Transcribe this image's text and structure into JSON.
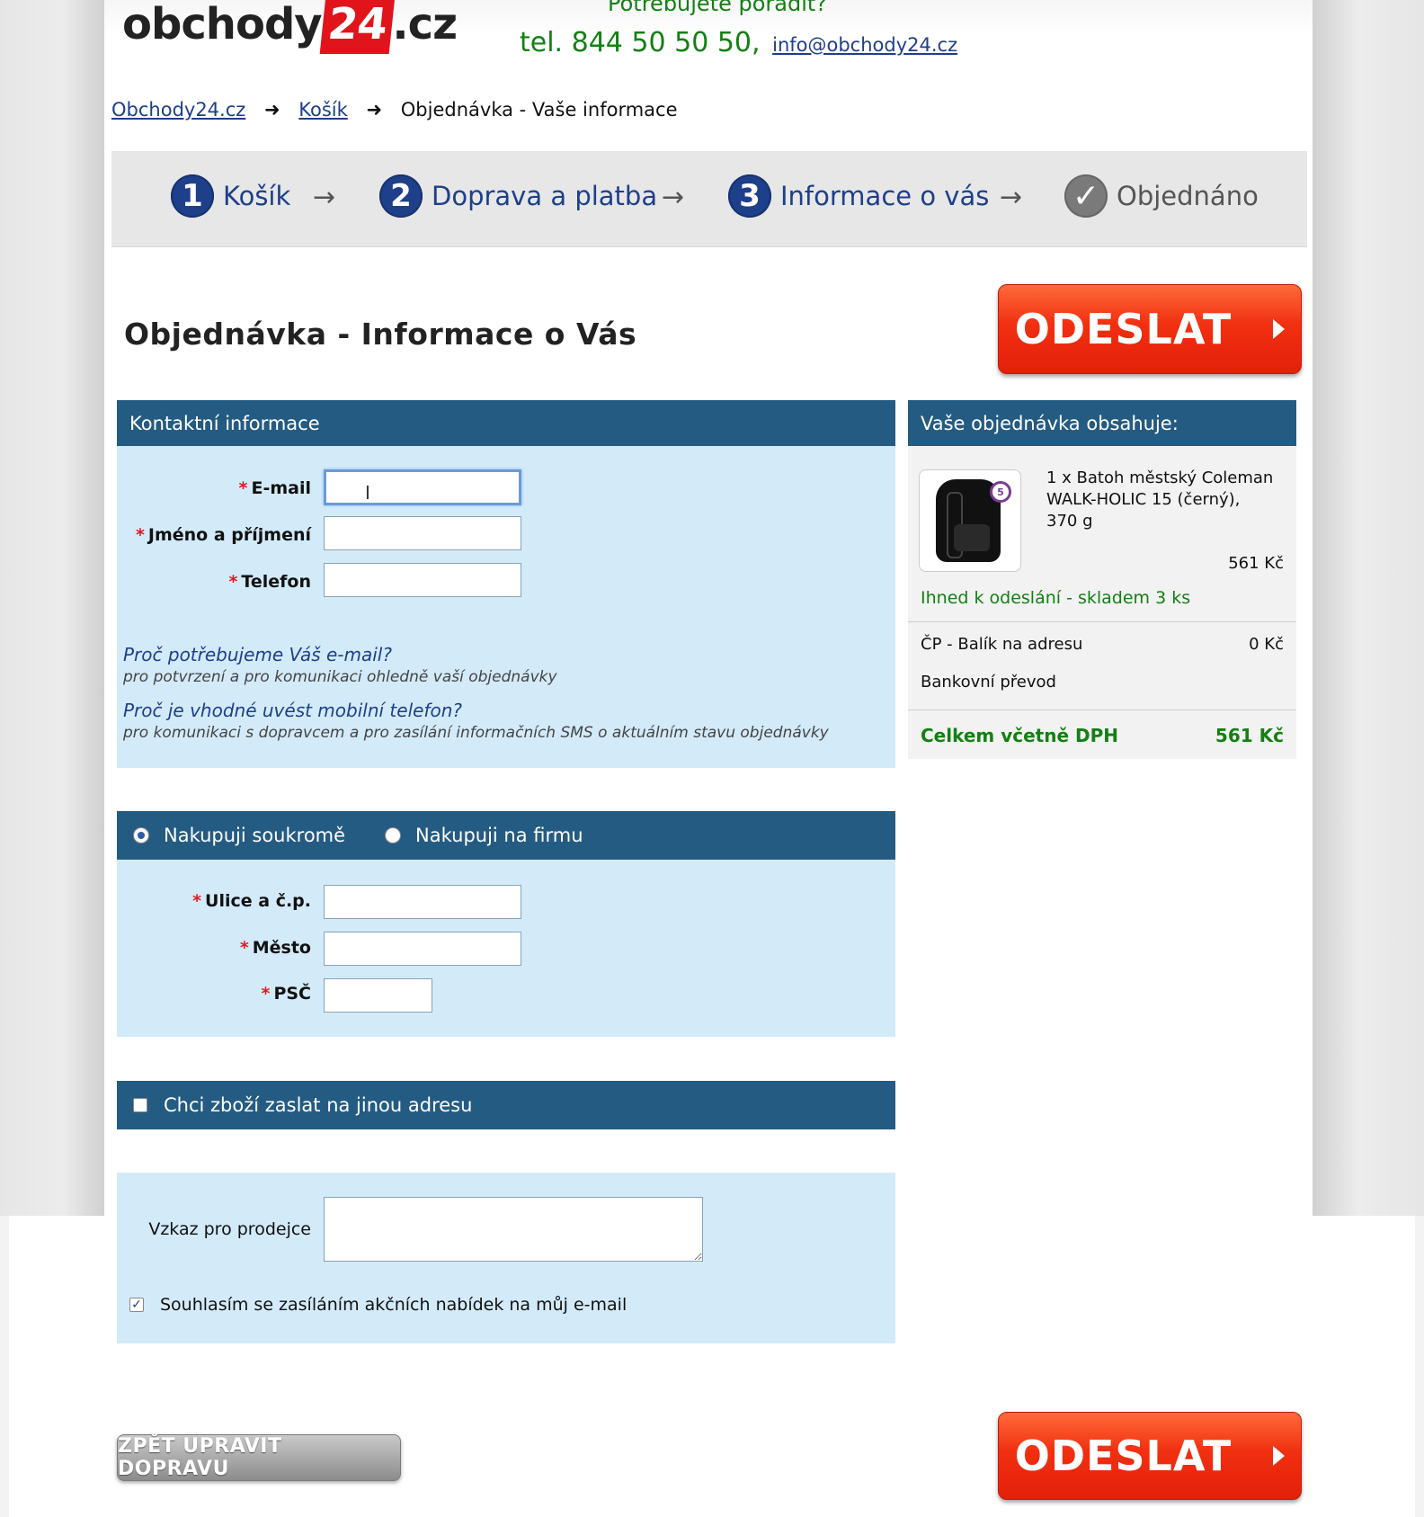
{
  "header": {
    "logo_left": "obchody",
    "logo_box": "24",
    "logo_right": ".cz",
    "advice": "Potřebujete poradit?",
    "phone": "tel. 844 50 50 50,",
    "email": "info@obchody24.cz"
  },
  "breadcrumb": [
    "Obchody24.cz",
    "Košík",
    "Objednávka - Vaše informace"
  ],
  "steps": [
    {
      "num": "1",
      "label": "Košík"
    },
    {
      "num": "2",
      "label": "Doprava a platba"
    },
    {
      "num": "3",
      "label": "Informace o vás"
    },
    {
      "num": "✓",
      "label": "Objednáno"
    }
  ],
  "page_title": "Objednávka - Informace o Vás",
  "submit_label": "ODESLAT",
  "contact": {
    "heading": "Kontaktní informace",
    "fields": [
      "E-mail",
      "Jméno a příjmení",
      "Telefon"
    ],
    "required_mark": "*",
    "hint1_q": "Proč potřebujeme Váš e-mail?",
    "hint1_a": "pro potvrzení a pro komunikaci ohledně vaší objednávky",
    "hint2_q": "Proč je vhodné uvést mobilní telefon?",
    "hint2_a": "pro komunikaci s dopravcem a pro zasílání informačních SMS o aktuálním stavu objednávky"
  },
  "buyer_type": {
    "private": "Nakupuji soukromě",
    "company": "Nakupuji na firmu",
    "selected": "private"
  },
  "address": {
    "fields": [
      "Ulice a č.p.",
      "Město",
      "PSČ"
    ]
  },
  "other_address": {
    "label": "Chci zboží zaslat na jinou adresu",
    "checked": false
  },
  "message": {
    "label": "Vzkaz pro prodejce",
    "value": ""
  },
  "newsletter": {
    "label": "Souhlasím se zasíláním akčních nabídek na můj e-mail",
    "checked": true
  },
  "order": {
    "heading": "Vaše objednávka obsahuje:",
    "item_line1": "1 x Batoh městský Coleman",
    "item_line2": "WALK-HOLIC 15 (černý),",
    "item_line3": "370 g",
    "item_price": "561 Kč",
    "badge": "5",
    "stock": "Ihned k odeslání - skladem 3 ks",
    "shipping_label": "ČP - Balík na adresu",
    "shipping_price": "0 Kč",
    "payment_label": "Bankovní převod",
    "total_label": "Celkem včetně DPH",
    "total_price": "561 Kč"
  },
  "back_button": "ZPĚT UPRAVIT DOPRAVU",
  "colors": {
    "brand_red": "#e1141c",
    "panel_blue": "#245b82",
    "panel_light": "#d3eaf9",
    "green": "#138013",
    "link_blue": "#1e3f8a"
  }
}
